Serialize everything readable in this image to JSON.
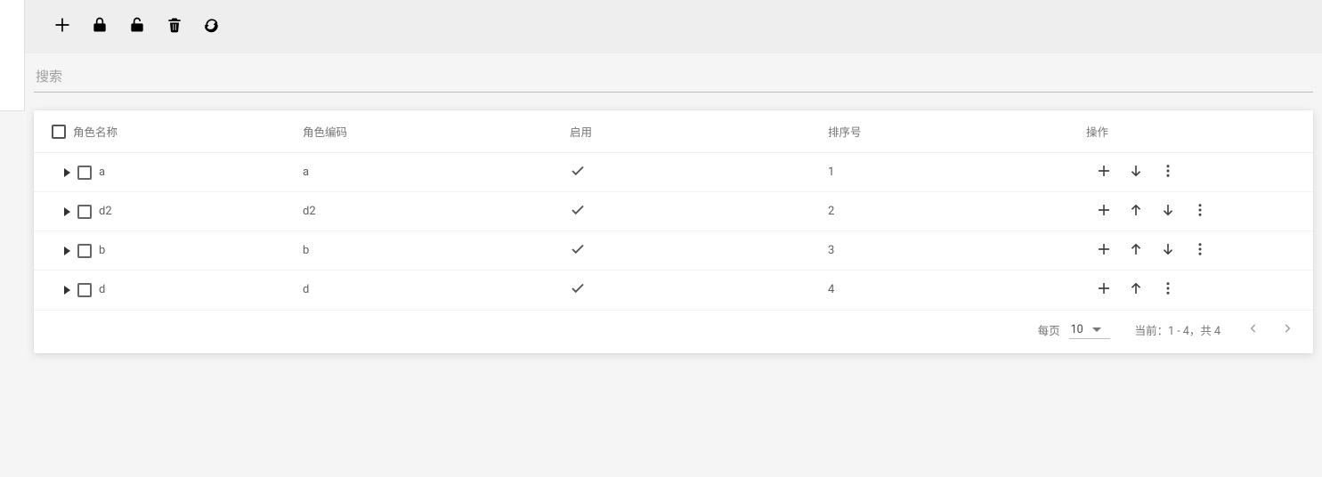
{
  "search": {
    "placeholder": "搜索"
  },
  "table": {
    "headers": {
      "name": "角色名称",
      "code": "角色编码",
      "enabled": "启用",
      "sort": "排序号",
      "actions": "操作"
    },
    "rows": [
      {
        "name": "a",
        "code": "a",
        "enabled": true,
        "sort": "1",
        "canUp": false,
        "canDown": true
      },
      {
        "name": "d2",
        "code": "d2",
        "enabled": true,
        "sort": "2",
        "canUp": true,
        "canDown": true
      },
      {
        "name": "b",
        "code": "b",
        "enabled": true,
        "sort": "3",
        "canUp": true,
        "canDown": true
      },
      {
        "name": "d",
        "code": "d",
        "enabled": true,
        "sort": "4",
        "canUp": true,
        "canDown": false
      }
    ]
  },
  "pagination": {
    "per_page_label": "每页",
    "per_page_value": "10",
    "range_text": "当前：1 - 4，共 4"
  }
}
